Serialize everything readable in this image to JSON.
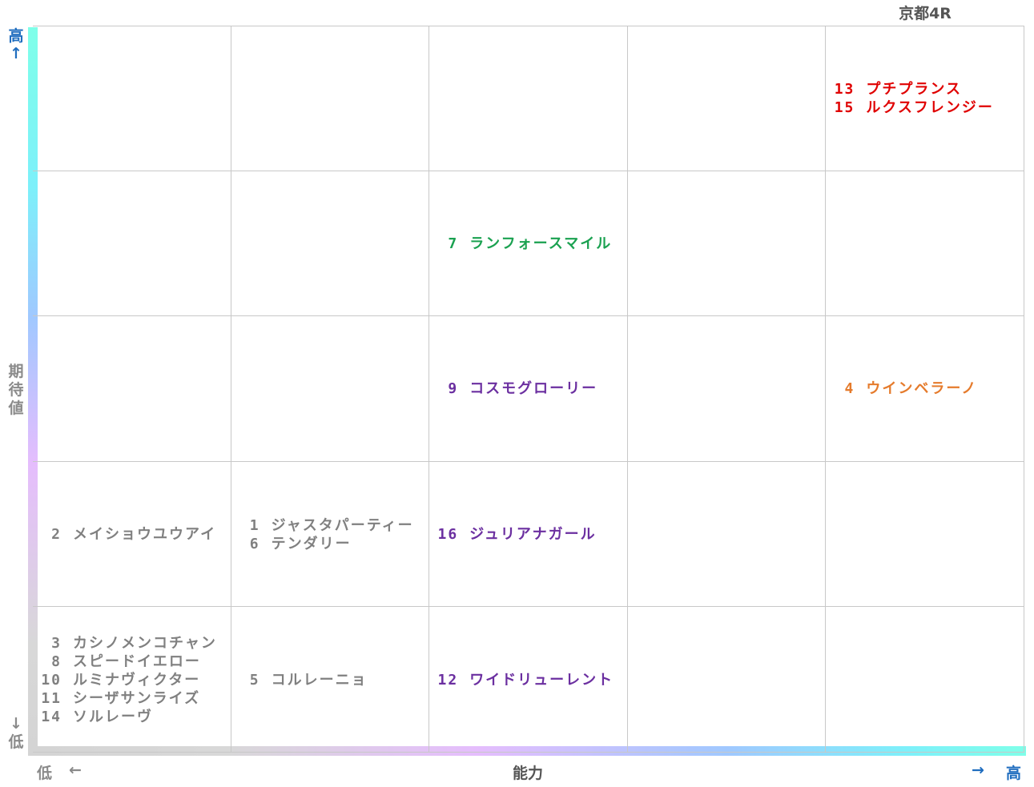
{
  "title": "京都4R",
  "axes": {
    "x_label": "能力",
    "x_low": "低",
    "x_high": "高",
    "x_low_arrow": "←",
    "x_high_arrow": "→",
    "y_label": "期待値",
    "y_high": "高",
    "y_low": "低",
    "y_high_arrow": "↑",
    "y_low_arrow": "↓"
  },
  "colors": {
    "red": "#e00000",
    "green": "#1aa150",
    "orange": "#e57b2c",
    "purple": "#6b2fa0",
    "gray": "#808080"
  },
  "chart_data": {
    "type": "table",
    "title": "京都4R",
    "xlabel": "能力",
    "ylabel": "期待値",
    "columns": 5,
    "rows": 5,
    "cells": [
      {
        "row": 0,
        "col": 4,
        "color": "#e00000",
        "entries": [
          {
            "num": "13",
            "name": "プチプランス"
          },
          {
            "num": "15",
            "name": "ルクスフレンジー"
          }
        ]
      },
      {
        "row": 1,
        "col": 2,
        "color": "#1aa150",
        "entries": [
          {
            "num": "7",
            "name": "ランフォースマイル"
          }
        ]
      },
      {
        "row": 2,
        "col": 2,
        "color": "#6b2fa0",
        "entries": [
          {
            "num": "9",
            "name": "コスモグローリー"
          }
        ]
      },
      {
        "row": 2,
        "col": 4,
        "color": "#e57b2c",
        "entries": [
          {
            "num": "4",
            "name": "ウインベラーノ"
          }
        ]
      },
      {
        "row": 3,
        "col": 0,
        "color": "#808080",
        "entries": [
          {
            "num": "2",
            "name": "メイショウユウアイ"
          }
        ]
      },
      {
        "row": 3,
        "col": 1,
        "color": "#808080",
        "entries": [
          {
            "num": "1",
            "name": "ジャスタパーティー"
          },
          {
            "num": "6",
            "name": "テンダリー"
          }
        ]
      },
      {
        "row": 3,
        "col": 2,
        "color": "#6b2fa0",
        "entries": [
          {
            "num": "16",
            "name": "ジュリアナガール"
          }
        ]
      },
      {
        "row": 4,
        "col": 0,
        "color": "#808080",
        "entries": [
          {
            "num": "3",
            "name": "カシノメンコチャン"
          },
          {
            "num": "8",
            "name": "スピードイエロー"
          },
          {
            "num": "10",
            "name": "ルミナヴィクター"
          },
          {
            "num": "11",
            "name": "シーザサンライズ"
          },
          {
            "num": "14",
            "name": "ソルレーヴ"
          }
        ]
      },
      {
        "row": 4,
        "col": 1,
        "color": "#808080",
        "entries": [
          {
            "num": "5",
            "name": "コルレーニョ"
          }
        ]
      },
      {
        "row": 4,
        "col": 2,
        "color": "#6b2fa0",
        "entries": [
          {
            "num": "12",
            "name": "ワイドリューレント"
          }
        ]
      }
    ]
  }
}
